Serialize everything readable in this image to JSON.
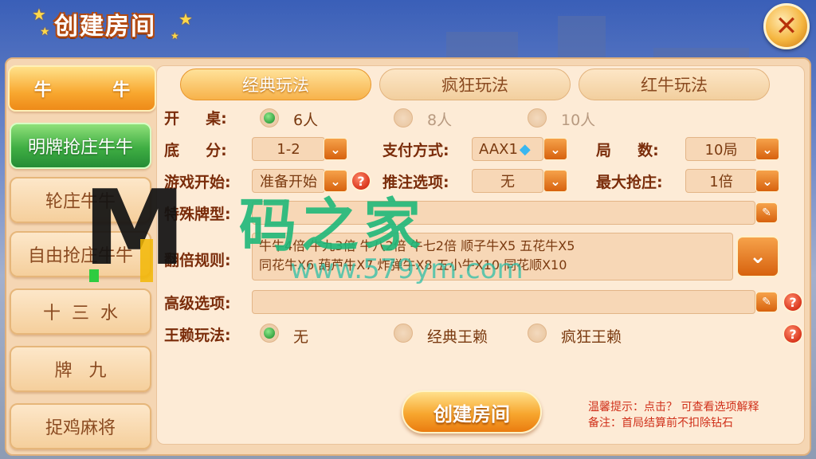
{
  "title": "创建房间",
  "close_icon": "close-icon",
  "sidebar": [
    {
      "label": "牛          牛",
      "state": "active"
    },
    {
      "label": "明牌抢庄牛牛",
      "state": "green"
    },
    {
      "label": "轮庄牛牛",
      "state": "normal"
    },
    {
      "label": "自由抢庄牛牛",
      "state": "normal"
    },
    {
      "label": "十  三  水",
      "state": "normal"
    },
    {
      "label": "牌   九",
      "state": "normal"
    },
    {
      "label": "捉鸡麻将",
      "state": "normal"
    }
  ],
  "tabs": [
    {
      "label": "经典玩法",
      "active": true
    },
    {
      "label": "疯狂玩法",
      "active": false
    },
    {
      "label": "红牛玩法",
      "active": false
    }
  ],
  "table_row": {
    "label": "开     桌:",
    "options": [
      {
        "text": "6人",
        "selected": true
      },
      {
        "text": "8人",
        "selected": false
      },
      {
        "text": "10人",
        "selected": false
      }
    ]
  },
  "base_score": {
    "label": "底     分:",
    "value": "1-2"
  },
  "payment": {
    "label": "支付方式:",
    "value": "AAX1"
  },
  "rounds": {
    "label": "局     数:",
    "value": "10局"
  },
  "game_start": {
    "label": "游戏开始:",
    "value": "准备开始"
  },
  "bet_option": {
    "label": "推注选项:",
    "value": "无"
  },
  "max_grab": {
    "label": "最大抢庄:",
    "value": "1倍"
  },
  "special_cards": {
    "label": "特殊牌型:",
    "value": ""
  },
  "double_rules": {
    "label": "翻倍规则:",
    "line1": "牛牛4倍 牛九3倍 牛八2倍 牛七2倍 顺子牛X5 五花牛X5",
    "line2": "同花牛X6 葫芦牛X7 炸弹牛X8 五小牛X10 同花顺X10"
  },
  "advanced": {
    "label": "高级选项:",
    "value": ""
  },
  "wildcard": {
    "label": "王赖玩法:",
    "options": [
      {
        "text": "无",
        "selected": true
      },
      {
        "text": "经典王赖",
        "selected": false
      },
      {
        "text": "疯狂王赖",
        "selected": false
      }
    ]
  },
  "create_button": "创建房间",
  "tips": {
    "line1": "温馨提示：点击？ 可查看选项解释",
    "line2": "备注：首局结算前不扣除钻石"
  },
  "watermark": {
    "logo": "M",
    "cn": "码之家",
    "url": "www.579ym.com"
  },
  "colors": {
    "accent": "#f7a62e",
    "panel": "#fdebd6",
    "label": "#7a2c0a",
    "help": "#d42a12"
  }
}
